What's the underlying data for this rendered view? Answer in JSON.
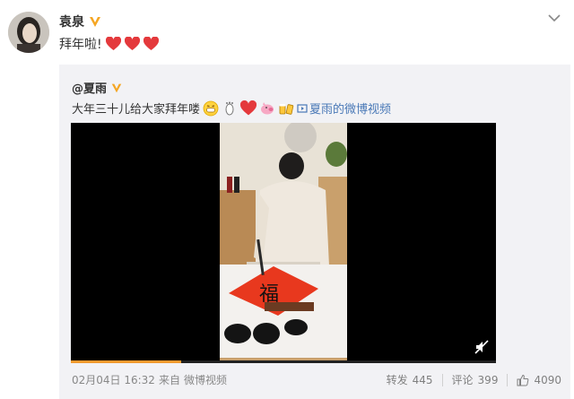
{
  "post": {
    "author": "袁泉",
    "text": "拜年啦!",
    "heart_count": 3
  },
  "repost": {
    "author": "@夏雨",
    "text": "大年三十儿给大家拜年喽",
    "video_link": "夏雨的微博视频",
    "video": {
      "progress": 0.26,
      "muted": true
    },
    "time": "02月04日 16:32",
    "source_prefix": "来自",
    "source": "微博视频",
    "actions": {
      "repost_label": "转发",
      "repost_count": "445",
      "comment_label": "评论",
      "comment_count": "399",
      "like_count": "4090"
    }
  },
  "colors": {
    "verified_badge": "#f5a623",
    "heart": "#e4393c",
    "link": "#4a79b7",
    "progress": "#f29a2f"
  }
}
